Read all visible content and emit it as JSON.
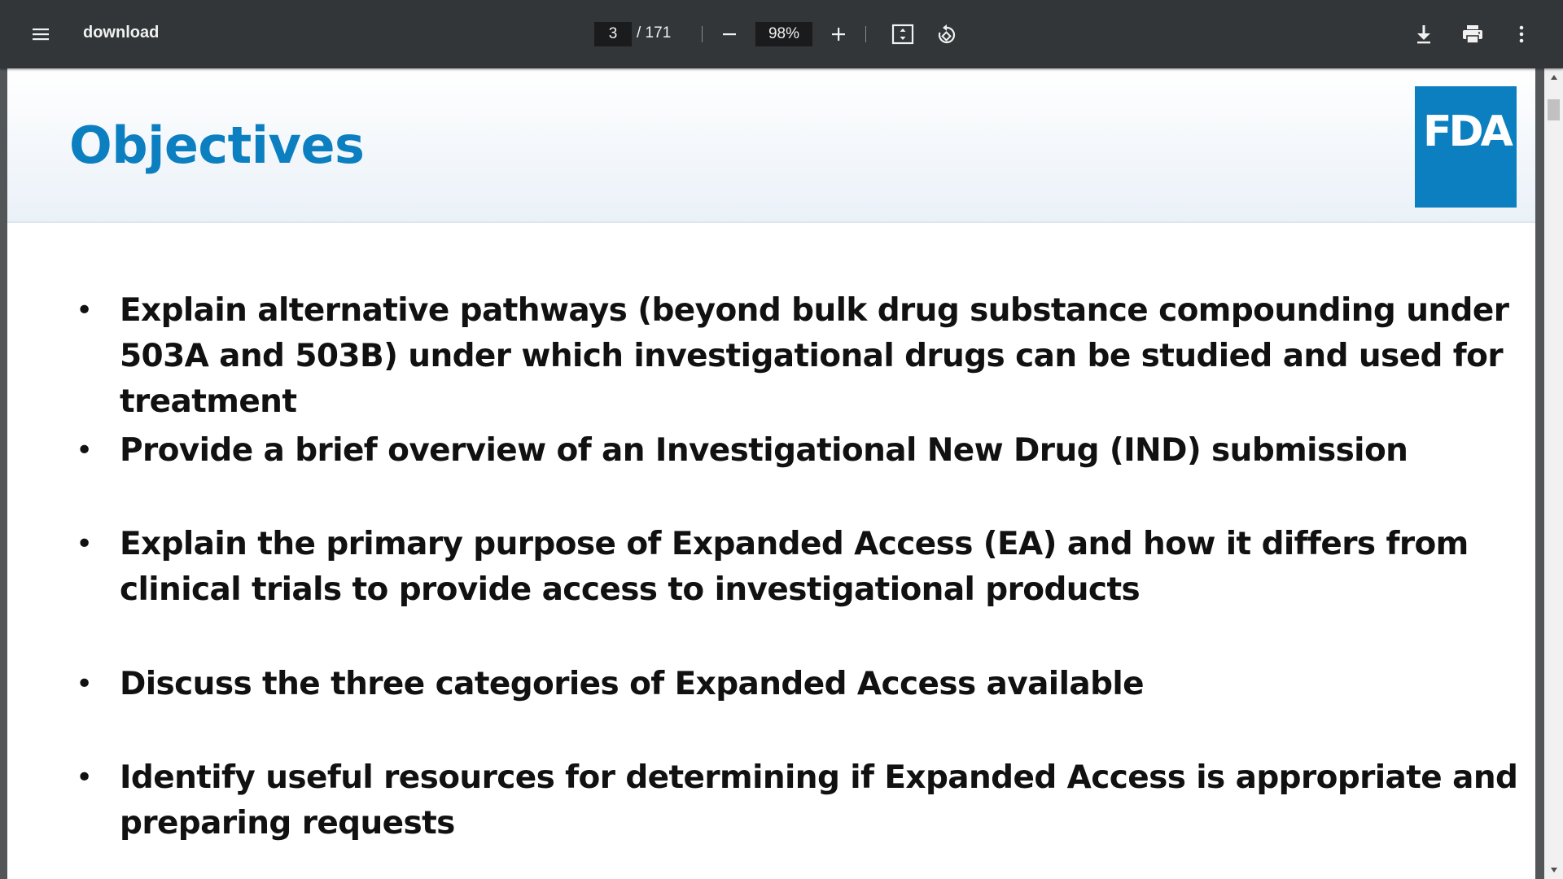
{
  "toolbar": {
    "title": "download",
    "page_current": "3",
    "page_total": "/ 171",
    "zoom": "98%",
    "icons": {
      "menu": "hamburger-menu-icon",
      "zoom_out": "minus-icon",
      "zoom_in": "plus-icon",
      "fit": "fit-to-page-icon",
      "rotate": "rotate-counterclockwise-icon",
      "download": "download-icon",
      "print": "print-icon",
      "more": "more-vertical-icon"
    }
  },
  "slide": {
    "title": "Objectives",
    "logo_text": "FDA",
    "bullets": [
      "Explain alternative pathways (beyond bulk drug substance compounding under 503A and 503B) under which investigational drugs can be studied and used for treatment",
      "Provide a brief overview of an Investigational New Drug (IND) submission",
      "Explain the primary purpose of Expanded Access (EA) and how it differs from clinical trials to provide access to investigational products",
      "Discuss the three categories of Expanded Access available",
      "Identify useful resources for determining if Expanded Access is appropriate and preparing requests"
    ],
    "bullet_symbol": "•"
  },
  "colors": {
    "toolbar_bg": "#323639",
    "viewer_bg": "#525659",
    "title_blue": "#0c7fc0",
    "logo_blue": "#0c7fc0"
  }
}
